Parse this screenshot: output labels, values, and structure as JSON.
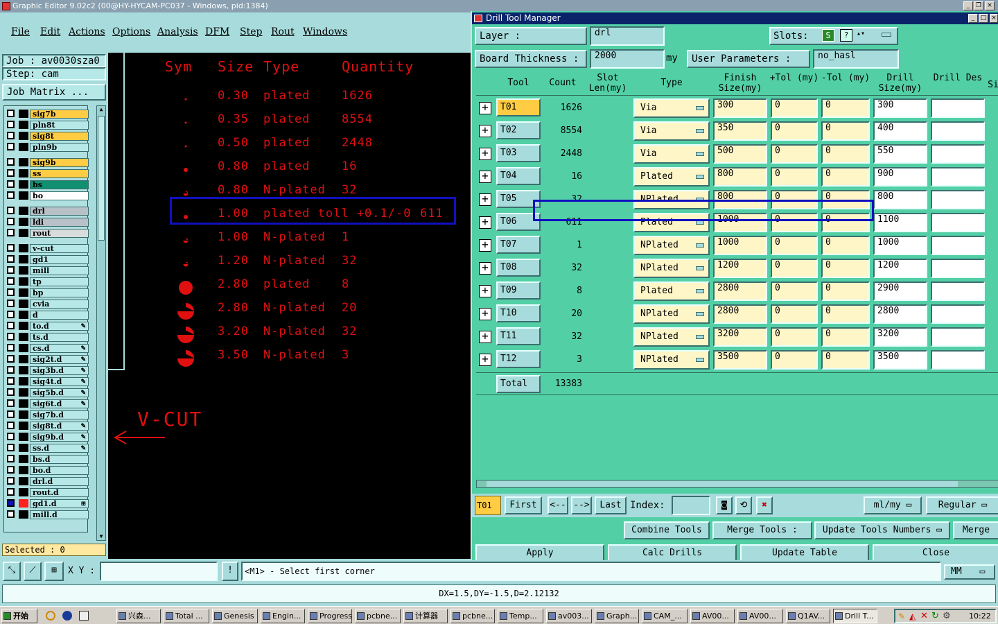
{
  "main_window": {
    "title": "Graphic Editor 9.02c2 (00@HY-HYCAM-PC037 - Windows, pid:1384)",
    "menu": [
      "File",
      "Edit",
      "Actions",
      "Options",
      "Analysis",
      "DFM",
      "Step",
      "Rout",
      "Windows"
    ]
  },
  "left_panel": {
    "job": "Job : av0030sza0",
    "step": "Step: cam",
    "job_matrix": "Job Matrix ...",
    "layers": [
      {
        "name": "sig7b",
        "cb": "#fff",
        "bg": "#ffcc44",
        "mark": ""
      },
      {
        "name": "pln8t",
        "cb": "#fff",
        "bg": "#b7e8e8",
        "mark": ""
      },
      {
        "name": "sig8t",
        "cb": "#fff",
        "bg": "#ffcc44",
        "mark": ""
      },
      {
        "name": "pln9b",
        "cb": "#fff",
        "bg": "#b7e8e8",
        "mark": ""
      },
      {
        "name": "sig9b",
        "cb": "#fff",
        "bg": "#ffcc44",
        "mark": ""
      },
      {
        "name": "ss",
        "cb": "#fff",
        "bg": "#ffcc44",
        "mark": ""
      },
      {
        "name": "bs",
        "cb": "#fff",
        "bg": "#109070",
        "mark": ""
      },
      {
        "name": "bo",
        "cb": "#fff",
        "bg": "#ffffff",
        "mark": ""
      },
      {
        "name": "drl",
        "cb": "#fff",
        "bg": "#b8c0c8",
        "mark": ""
      },
      {
        "name": "ldi",
        "cb": "#fff",
        "bg": "#b8c0c8",
        "mark": ""
      },
      {
        "name": "rout",
        "cb": "#fff",
        "bg": "#d8dcdc",
        "mark": ""
      },
      {
        "name": "v-cut",
        "cb": "#fff",
        "bg": "#b7e8e8",
        "mark": ""
      },
      {
        "name": "gd1",
        "cb": "#fff",
        "bg": "#b7e8e8",
        "mark": ""
      },
      {
        "name": "mill",
        "cb": "#fff",
        "bg": "#b7e8e8",
        "mark": ""
      },
      {
        "name": "tp",
        "cb": "#fff",
        "bg": "#b7e8e8",
        "mark": ""
      },
      {
        "name": "bp",
        "cb": "#fff",
        "bg": "#b7e8e8",
        "mark": ""
      },
      {
        "name": "cvia",
        "cb": "#fff",
        "bg": "#b7e8e8",
        "mark": ""
      },
      {
        "name": "d",
        "cb": "#fff",
        "bg": "#b7e8e8",
        "mark": ""
      },
      {
        "name": "to.d",
        "cb": "#fff",
        "bg": "#b7e8e8",
        "mark": "✎"
      },
      {
        "name": "ts.d",
        "cb": "#fff",
        "bg": "#b7e8e8",
        "mark": ""
      },
      {
        "name": "cs.d",
        "cb": "#fff",
        "bg": "#b7e8e8",
        "mark": "✎"
      },
      {
        "name": "sig2t.d",
        "cb": "#fff",
        "bg": "#b7e8e8",
        "mark": "✎"
      },
      {
        "name": "sig3b.d",
        "cb": "#fff",
        "bg": "#b7e8e8",
        "mark": "✎"
      },
      {
        "name": "sig4t.d",
        "cb": "#fff",
        "bg": "#b7e8e8",
        "mark": "✎"
      },
      {
        "name": "sig5b.d",
        "cb": "#fff",
        "bg": "#b7e8e8",
        "mark": "✎"
      },
      {
        "name": "sig6t.d",
        "cb": "#fff",
        "bg": "#b7e8e8",
        "mark": "✎"
      },
      {
        "name": "sig7b.d",
        "cb": "#fff",
        "bg": "#b7e8e8",
        "mark": ""
      },
      {
        "name": "sig8t.d",
        "cb": "#fff",
        "bg": "#b7e8e8",
        "mark": "✎"
      },
      {
        "name": "sig9b.d",
        "cb": "#fff",
        "bg": "#b7e8e8",
        "mark": "✎"
      },
      {
        "name": "ss.d",
        "cb": "#fff",
        "bg": "#b7e8e8",
        "mark": "✎"
      },
      {
        "name": "bs.d",
        "cb": "#fff",
        "bg": "#b7e8e8",
        "mark": ""
      },
      {
        "name": "bo.d",
        "cb": "#fff",
        "bg": "#b7e8e8",
        "mark": ""
      },
      {
        "name": "drl.d",
        "cb": "#fff",
        "bg": "#b7e8e8",
        "mark": ""
      },
      {
        "name": "rout.d",
        "cb": "#fff",
        "bg": "#b7e8e8",
        "mark": ""
      },
      {
        "name": "gd1.d",
        "cb": "#1010c0",
        "bg": "#b7e8e8",
        "mark": "⊞",
        "swatch": "#ff2020"
      },
      {
        "name": "mill.d",
        "cb": "#fff",
        "bg": "#b7e8e8",
        "mark": ""
      }
    ],
    "selected": "Selected : 0"
  },
  "canvas": {
    "headers": {
      "sym": "Sym",
      "size": "Size",
      "type": "Type",
      "quantity": "Quantity"
    },
    "rows": [
      {
        "sym": "dot-xs",
        "size": "0.30",
        "type": "plated",
        "qty": "1626"
      },
      {
        "sym": "dot-xs",
        "size": "0.35",
        "type": "plated",
        "qty": "8554"
      },
      {
        "sym": "dot-xs",
        "size": "0.50",
        "type": "plated",
        "qty": "2448"
      },
      {
        "sym": "dot-s",
        "size": "0.80",
        "type": "plated",
        "qty": "16"
      },
      {
        "sym": "half-s",
        "size": "0.80",
        "type": "N-plated",
        "qty": "32"
      },
      {
        "sym": "dot-s",
        "size": "1.00",
        "type": "plated toll +0.1/-0",
        "qty": "611"
      },
      {
        "sym": "half-s",
        "size": "1.00",
        "type": "N-plated",
        "qty": "1"
      },
      {
        "sym": "half-s",
        "size": "1.20",
        "type": "N-plated",
        "qty": "32"
      },
      {
        "sym": "dot-l",
        "size": "2.80",
        "type": "plated",
        "qty": "8"
      },
      {
        "sym": "half-l",
        "size": "2.80",
        "type": "N-plated",
        "qty": "20"
      },
      {
        "sym": "half-l",
        "size": "3.20",
        "type": "N-plated",
        "qty": "32"
      },
      {
        "sym": "half-l",
        "size": "3.50",
        "type": "N-plated",
        "qty": "3"
      }
    ],
    "vcut_label": "V-CUT"
  },
  "dtm": {
    "title": "Drill Tool Manager",
    "layer_label": "Layer        :",
    "layer_value": "drl",
    "slots_label": "Slots:",
    "board_thickness_label": "Board Thickness :",
    "board_thickness_value": "2000",
    "unit_my": "my",
    "user_params_label": "User Parameters :",
    "user_params_value": "no_hasl",
    "columns": {
      "tool": "Tool",
      "count": "Count",
      "slot_len": "Slot Len(my)",
      "type": "Type",
      "finish": "Finish Size(my)",
      "ptol": "+Tol (my)",
      "ntol": "-Tol (my)",
      "drill": "Drill Size(my)",
      "drill_des": "Drill Des",
      "si": "Si"
    },
    "rows": [
      {
        "tool": "T01",
        "count": "1626",
        "type": "Via",
        "finish": "300",
        "ptol": "0",
        "ntol": "0",
        "drill": "300",
        "current": true
      },
      {
        "tool": "T02",
        "count": "8554",
        "type": "Via",
        "finish": "350",
        "ptol": "0",
        "ntol": "0",
        "drill": "400"
      },
      {
        "tool": "T03",
        "count": "2448",
        "type": "Via",
        "finish": "500",
        "ptol": "0",
        "ntol": "0",
        "drill": "550"
      },
      {
        "tool": "T04",
        "count": "16",
        "type": "Plated",
        "finish": "800",
        "ptol": "0",
        "ntol": "0",
        "drill": "900"
      },
      {
        "tool": "T05",
        "count": "32",
        "type": "NPlated",
        "finish": "800",
        "ptol": "0",
        "ntol": "0",
        "drill": "800"
      },
      {
        "tool": "T06",
        "count": "611",
        "type": "Plated",
        "finish": "1000",
        "ptol": "0",
        "ntol": "0",
        "drill": "1100"
      },
      {
        "tool": "T07",
        "count": "1",
        "type": "NPlated",
        "finish": "1000",
        "ptol": "0",
        "ntol": "0",
        "drill": "1000"
      },
      {
        "tool": "T08",
        "count": "32",
        "type": "NPlated",
        "finish": "1200",
        "ptol": "0",
        "ntol": "0",
        "drill": "1200"
      },
      {
        "tool": "T09",
        "count": "8",
        "type": "Plated",
        "finish": "2800",
        "ptol": "0",
        "ntol": "0",
        "drill": "2900"
      },
      {
        "tool": "T10",
        "count": "20",
        "type": "NPlated",
        "finish": "2800",
        "ptol": "0",
        "ntol": "0",
        "drill": "2800"
      },
      {
        "tool": "T11",
        "count": "32",
        "type": "NPlated",
        "finish": "3200",
        "ptol": "0",
        "ntol": "0",
        "drill": "3200"
      },
      {
        "tool": "T12",
        "count": "3",
        "type": "NPlated",
        "finish": "3500",
        "ptol": "0",
        "ntol": "0",
        "drill": "3500"
      }
    ],
    "total_label": "Total",
    "total_value": "13383",
    "nav": {
      "current": "T01",
      "first": "First",
      "prev": "<--",
      "next": "-->",
      "last": "Last",
      "index_label": "Index:",
      "units": "ml/my",
      "mode": "Regular"
    },
    "ops": {
      "combine": "Combine Tools",
      "merge": "Merge Tools :",
      "update_numbers": "Update Tools Numbers",
      "merge2": "Merge"
    },
    "actions": {
      "apply": "Apply",
      "calc": "Calc Drills",
      "update": "Update Table",
      "close": "Close"
    }
  },
  "command_bar": {
    "xy_label": "X Y :",
    "prompt": "<M1> - Select first corner",
    "units": "MM"
  },
  "status": "DX=1.5,DY=-1.5,D=2.12132",
  "taskbar": {
    "start": "开始",
    "clock": "10:22",
    "tasks": [
      "兴森...",
      "Total ...",
      "Genesis",
      "Engin...",
      "Progress",
      "pcbne...",
      "计算器",
      "pcbne...",
      "Temp...",
      "av003...",
      "Graph...",
      "CAM_...",
      "AV00...",
      "AV00...",
      "Q1AV...",
      "Drill T..."
    ]
  }
}
